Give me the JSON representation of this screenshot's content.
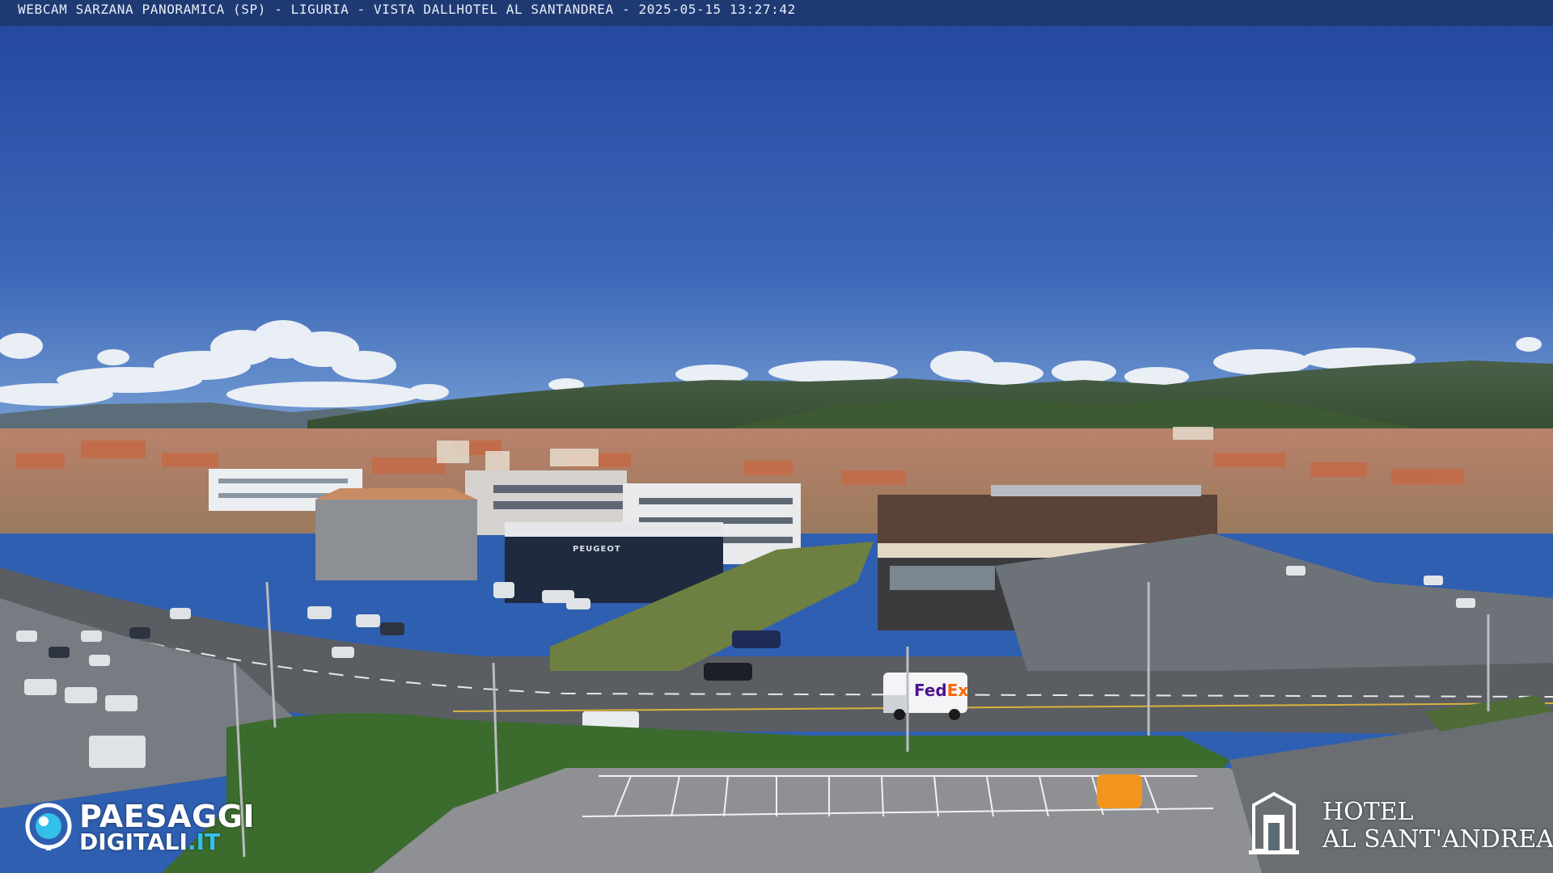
{
  "overlay": {
    "caption": "WEBCAM SARZANA PANORAMICA (SP) - LIGURIA - VISTA DALLHOTEL AL SANTANDREA - 2025-05-15  13:27:42"
  },
  "brand_left": {
    "line1": "PAESAGGI",
    "line2_main": "DIGITALI",
    "line2_accent": ".IT",
    "icon": "eye-icon"
  },
  "brand_right": {
    "line1": "HOTEL",
    "line2": "AL SANT'ANDREA",
    "icon": "building-icon"
  },
  "signs": {
    "dealership": "PEUGEOT",
    "van_logo_fed": "Fed",
    "van_logo_ex": "Ex"
  },
  "colors": {
    "sky_top": "#2a4fa3",
    "sky_bottom": "#5b86c8",
    "hills": "#3f5638",
    "road": "#5a5e63"
  }
}
